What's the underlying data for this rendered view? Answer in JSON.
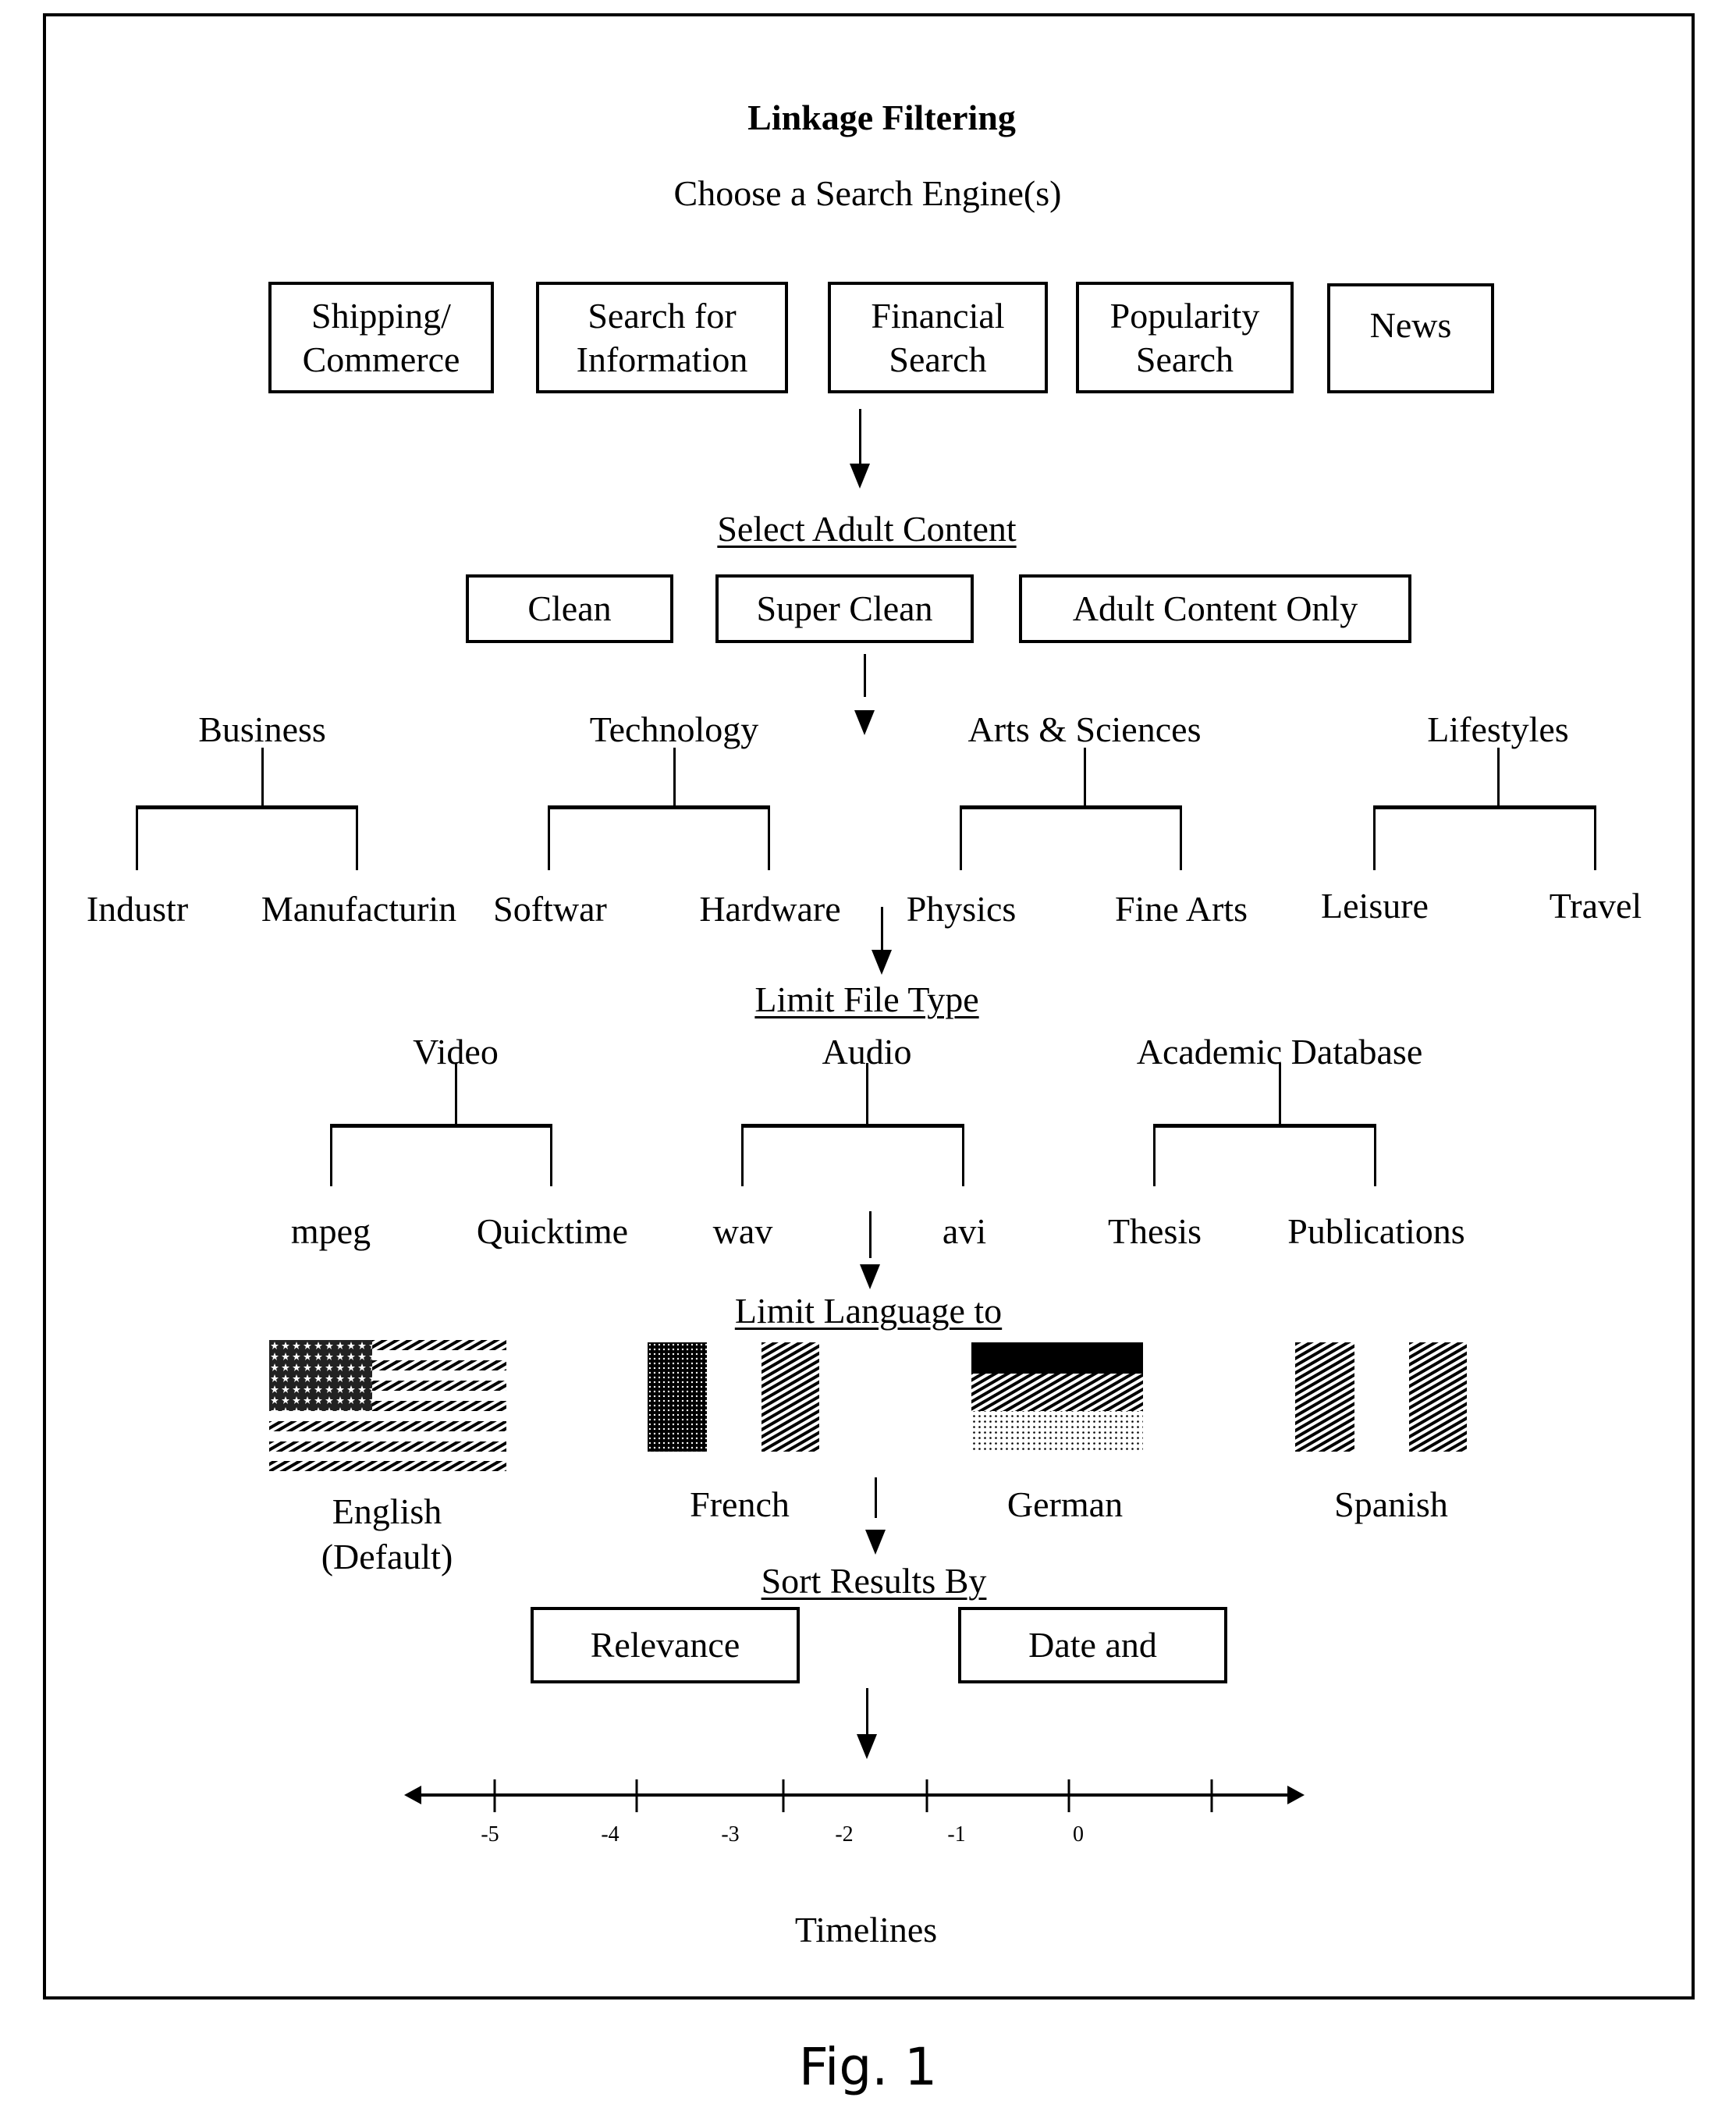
{
  "title": "Linkage Filtering",
  "subtitle": "Choose a Search Engine(s)",
  "search_engines": [
    {
      "line1": "Shipping/",
      "line2": "Commerce"
    },
    {
      "line1": "Search for",
      "line2": "Information"
    },
    {
      "line1": "Financial",
      "line2": "Search"
    },
    {
      "line1": "Popularity",
      "line2": "Search"
    },
    {
      "line1": "News",
      "line2": ""
    }
  ],
  "adult_content": {
    "heading": "Select Adult Content",
    "options": [
      "Clean",
      "Super Clean",
      "Adult Content Only"
    ]
  },
  "categories": [
    {
      "name": "Business",
      "children": [
        "Industr",
        "Manufacturin"
      ]
    },
    {
      "name": "Technology",
      "children": [
        "Softwar",
        "Hardware"
      ]
    },
    {
      "name": "Arts & Sciences",
      "children": [
        "Physics",
        "Fine Arts"
      ]
    },
    {
      "name": "Lifestyles",
      "children": [
        "Leisure",
        "Travel"
      ]
    }
  ],
  "file_type": {
    "heading": "Limit File Type",
    "groups": [
      {
        "name": "Video",
        "children": [
          "mpeg",
          "Quicktime"
        ]
      },
      {
        "name": "Audio",
        "children": [
          "wav",
          "avi"
        ]
      },
      {
        "name": "Academic Database",
        "children": [
          "Thesis",
          "Publications"
        ]
      }
    ]
  },
  "language": {
    "heading": "Limit Language to",
    "options": [
      {
        "line1": "English",
        "line2": "(Default)",
        "flag": "us-flag-icon"
      },
      {
        "line1": "French",
        "line2": "",
        "flag": "french-flag-icon"
      },
      {
        "line1": "German",
        "line2": "",
        "flag": "german-flag-icon"
      },
      {
        "line1": "Spanish",
        "line2": "",
        "flag": "spanish-flag-icon"
      }
    ]
  },
  "sort": {
    "heading": "Sort Results By",
    "options": [
      "Relevance",
      "Date and"
    ]
  },
  "timeline": {
    "tick_labels": [
      "-5",
      "-4",
      "-3",
      "-2",
      "-1",
      "0"
    ],
    "label": "Timelines"
  },
  "figure_caption": "Fig. 1"
}
